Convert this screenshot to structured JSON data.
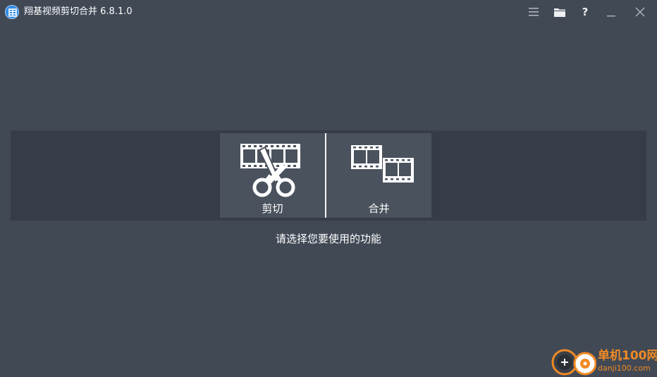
{
  "window": {
    "title": "翔基视频剪切合并 6.8.1.0",
    "background": "#414955"
  },
  "titlebar_buttons": [
    {
      "name": "menu",
      "icon": "menu-icon"
    },
    {
      "name": "open-folder",
      "icon": "folder-icon"
    },
    {
      "name": "help",
      "icon": "help-icon",
      "glyph": "?"
    },
    {
      "name": "minimize",
      "icon": "minimize-icon"
    },
    {
      "name": "close",
      "icon": "close-icon"
    }
  ],
  "functions": {
    "cut": {
      "label": "剪切",
      "icon": "film-scissors-icon"
    },
    "merge": {
      "label": "合并",
      "icon": "film-merge-icon"
    }
  },
  "hint": "请选择您要使用的功能",
  "watermark": {
    "title": "单机100网",
    "url": "danji100.com",
    "color": "#f08a24"
  }
}
